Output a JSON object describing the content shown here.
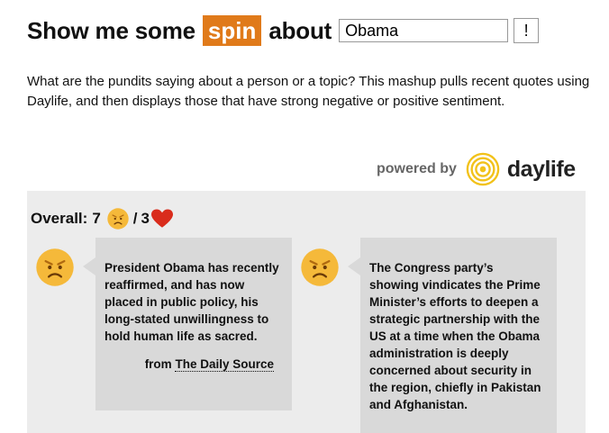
{
  "header": {
    "prefix": "Show me some",
    "spin": "spin",
    "suffix": "about",
    "search_value": "Obama",
    "go_label": "!"
  },
  "intro": "What are the pundits saying about a person or a topic? This mashup pulls recent quotes using Daylife, and then displays those that have strong negative or positive sentiment.",
  "powered": {
    "label": "powered by",
    "brand": "daylife"
  },
  "overall": {
    "label": "Overall:",
    "negative_count": "7",
    "separator": "/",
    "positive_count": "3"
  },
  "quotes": [
    {
      "text": "President Obama has recently reaffirmed, and has now placed in public policy, his long-stated unwillingness to hold human life as sacred.",
      "from": "from",
      "source": "The Daily Source"
    },
    {
      "text": "The Congress party’s showing vindicates the Prime Minister’s efforts to deepen a strategic partnership with the US at a time when the Obama administration is deeply concerned about security in the region, chiefly in Pakistan and Afghanistan."
    }
  ],
  "colors": {
    "spin_bg": "#e07a1a",
    "panel_bg": "#ececec",
    "bubble_bg": "#d9d9d9",
    "face_yellow": "#f5b93a",
    "heart_red": "#d92c1c",
    "logo_yellow": "#f2c21a"
  },
  "icons": [
    "daylife-logo-icon",
    "angry-face-icon",
    "heart-icon"
  ]
}
